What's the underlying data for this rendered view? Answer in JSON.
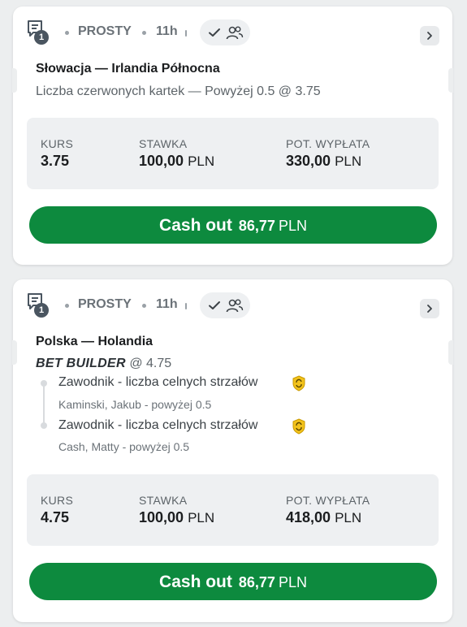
{
  "colors": {
    "cashout_bg": "#0d8a3e",
    "page_bg": "#eceeef",
    "stats_bg": "#eef0f2",
    "boost_icon": "#f2c21b"
  },
  "icons": {
    "ticket": "ticket-icon",
    "check": "check-icon",
    "users": "users-icon",
    "arrow": "chevron-right-icon",
    "boost": "boost-shield-icon"
  },
  "bets": [
    {
      "badge": "1",
      "type": "PROSTY",
      "time": "11h",
      "match": "Słowacja — Irlandia Północna",
      "selection": "Liczba czerwonych kartek — Powyżej 0.5 @ 3.75",
      "stats": {
        "odds_label": "KURS",
        "odds": "3.75",
        "stake_label": "STAWKA",
        "stake": "100,00",
        "stake_cur": "PLN",
        "payout_label": "POT. WYPŁATA",
        "payout": "330,00",
        "payout_cur": "PLN"
      },
      "cashout": {
        "label": "Cash out",
        "amount": "86,77",
        "currency": "PLN"
      }
    },
    {
      "badge": "1",
      "type": "PROSTY",
      "time": "11h",
      "match": "Polska — Holandia",
      "bet_builder": "BET BUILDER",
      "bet_builder_odds": "@ 4.75",
      "legs": [
        {
          "title": "Zawodnik - liczba celnych strzałów",
          "sub": "Kaminski, Jakub - powyżej 0.5"
        },
        {
          "title": "Zawodnik - liczba celnych strzałów",
          "sub": "Cash, Matty - powyżej 0.5"
        }
      ],
      "stats": {
        "odds_label": "KURS",
        "odds": "4.75",
        "stake_label": "STAWKA",
        "stake": "100,00",
        "stake_cur": "PLN",
        "payout_label": "POT. WYPŁATA",
        "payout": "418,00",
        "payout_cur": "PLN"
      },
      "cashout": {
        "label": "Cash out",
        "amount": "86,77",
        "currency": "PLN"
      }
    }
  ]
}
